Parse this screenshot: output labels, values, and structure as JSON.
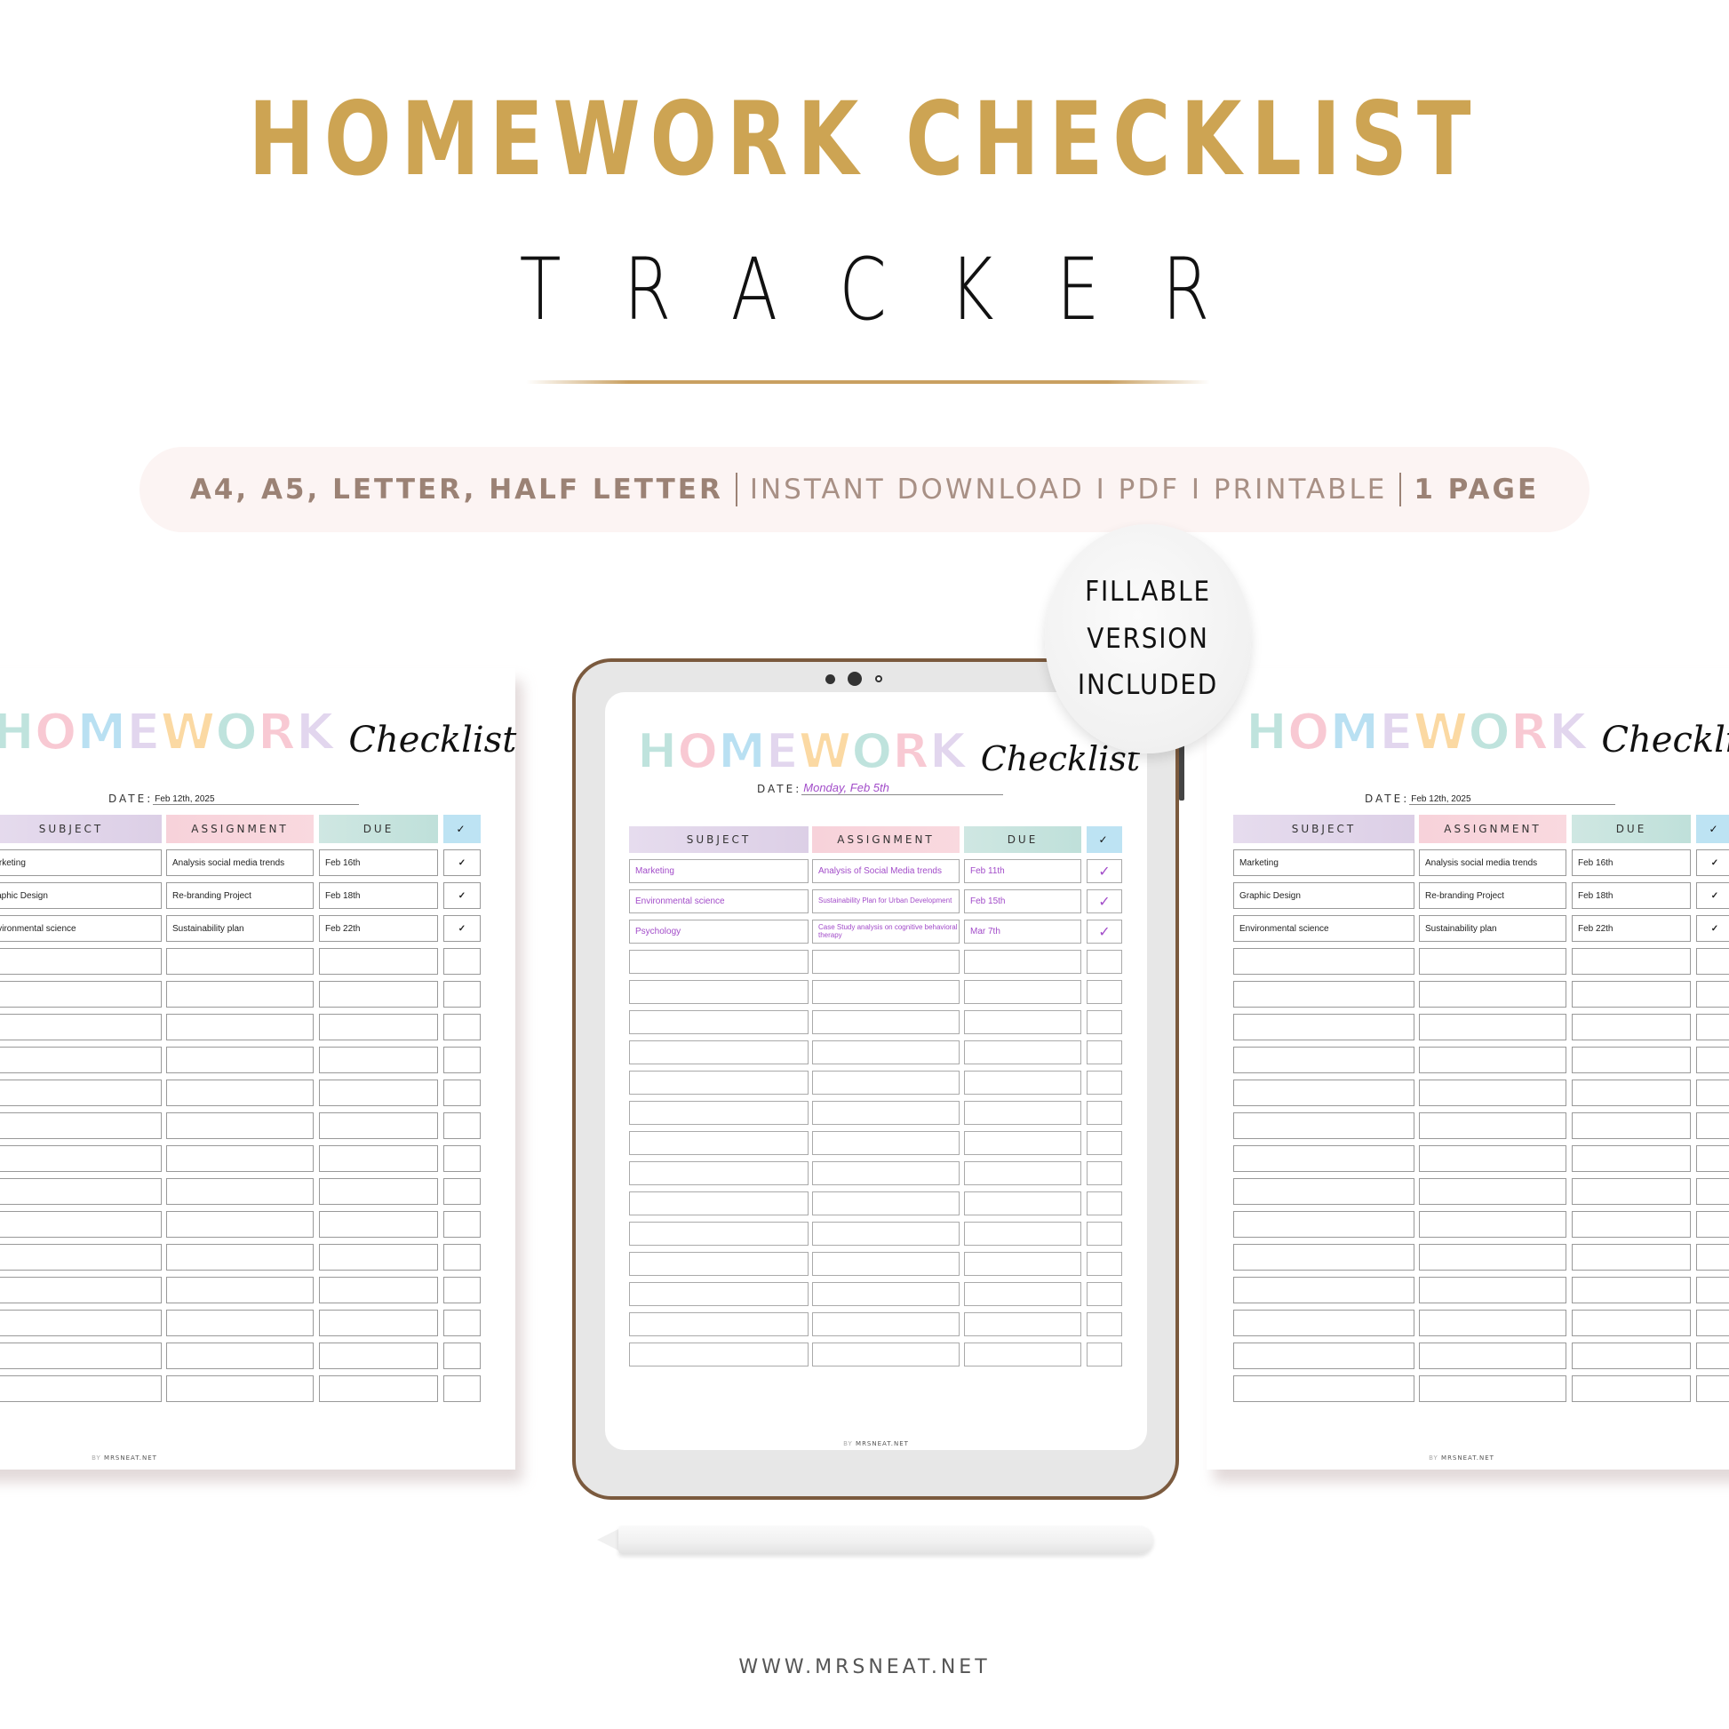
{
  "header": {
    "title": "HOMEWORK CHECKLIST",
    "subtitle": "TRACKER"
  },
  "info_bar": {
    "formats": "A4, A5, LETTER, HALF LETTER",
    "delivery": "INSTANT DOWNLOAD I PDF I PRINTABLE",
    "pages": "1 PAGE"
  },
  "badge": {
    "line1": "FILLABLE",
    "line2": "VERSION",
    "line3": "INCLUDED"
  },
  "planner": {
    "heading_word": [
      "H",
      "O",
      "M",
      "E",
      "W",
      "O",
      "R",
      "K"
    ],
    "heading_colors": [
      "#bfe3dd",
      "#f8c9d3",
      "#b9e0f2",
      "#e2d6ee",
      "#fbd9a3",
      "#bfe3dd",
      "#f8c9d3",
      "#e2d6ee"
    ],
    "heading_script": "Checklist",
    "date_label": "DATE:",
    "columns": {
      "subject": "SUBJECT",
      "assignment": "ASSIGNMENT",
      "due": "DUE",
      "check": "✓"
    },
    "credit_by": "BY",
    "credit_site": "MRSNEAT.NET"
  },
  "left_page": {
    "date": "Feb 12th, 2025",
    "rows": [
      {
        "subject": "Marketing",
        "assignment": "Analysis social media trends",
        "due": "Feb 16th",
        "done": "✓"
      },
      {
        "subject": "Graphic Design",
        "assignment": "Re-branding Project",
        "due": "Feb 18th",
        "done": "✓"
      },
      {
        "subject": "Environmental science",
        "assignment": "Sustainability plan",
        "due": "Feb 22th",
        "done": "✓"
      }
    ],
    "empty_rows": 14
  },
  "tablet_page": {
    "date": "Monday, Feb 5th",
    "rows": [
      {
        "subject": "Marketing",
        "assignment": "Analysis of Social Media trends",
        "due": "Feb 11th",
        "done": "✓"
      },
      {
        "subject": "Environmental science",
        "assignment": "Sustainability Plan for Urban Development",
        "due": "Feb 15th",
        "done": "✓"
      },
      {
        "subject": "Psychology",
        "assignment": "Case Study analysis on cognitive behavioral therapy",
        "due": "Mar 7th",
        "done": "✓"
      }
    ],
    "empty_rows": 14
  },
  "right_page": {
    "date": "Feb 12th, 2025",
    "rows": [
      {
        "subject": "Marketing",
        "assignment": "Analysis social media trends",
        "due": "Feb 16th",
        "done": "✓"
      },
      {
        "subject": "Graphic Design",
        "assignment": "Re-branding Project",
        "due": "Feb 18th",
        "done": "✓"
      },
      {
        "subject": "Environmental science",
        "assignment": "Sustainability plan",
        "due": "Feb 22th",
        "done": "✓"
      }
    ],
    "empty_rows": 14
  },
  "footer": {
    "url": "WWW.MRSNEAT.NET"
  },
  "colors": {
    "gold": "#cda453",
    "tablet_frame": "#7b5a3e",
    "fillable_text": "#a24cc9",
    "pill_bg": "#fcf4f3",
    "pill_text": "#9b8275"
  }
}
